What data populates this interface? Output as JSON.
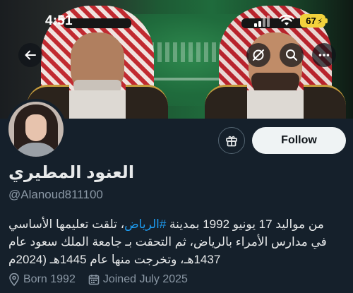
{
  "status_bar": {
    "time": "4:51",
    "battery": "67"
  },
  "header": {
    "back_icon": "arrow-left-icon",
    "grok_icon": "grok-icon",
    "search_icon": "search-icon",
    "more_icon": "more-horizontal-icon"
  },
  "profile": {
    "display_name": "العنود المطيري",
    "handle": "@Alanoud811100",
    "follow_label": "Follow",
    "gift_icon": "gift-icon",
    "bio": {
      "line1_prefix": "من مواليد 17 يونيو 1992 بمدينة ",
      "hashtag": "#الرياض",
      "line1_suffix": "، تلقت تعليمها الأساسي",
      "line2": "في مدارس الأمراء بالرياض، ثم التحقت بـ جامعة الملك سعود عام",
      "line3": "1437هـ، وتخرجت منها عام 1445هـ (2024م"
    },
    "born": "Born 1992",
    "joined": "Joined July 2025"
  },
  "colors": {
    "background": "#15202b",
    "accent": "#1d9bf0",
    "muted": "#8b98a5",
    "battery": "#f2d23c"
  }
}
